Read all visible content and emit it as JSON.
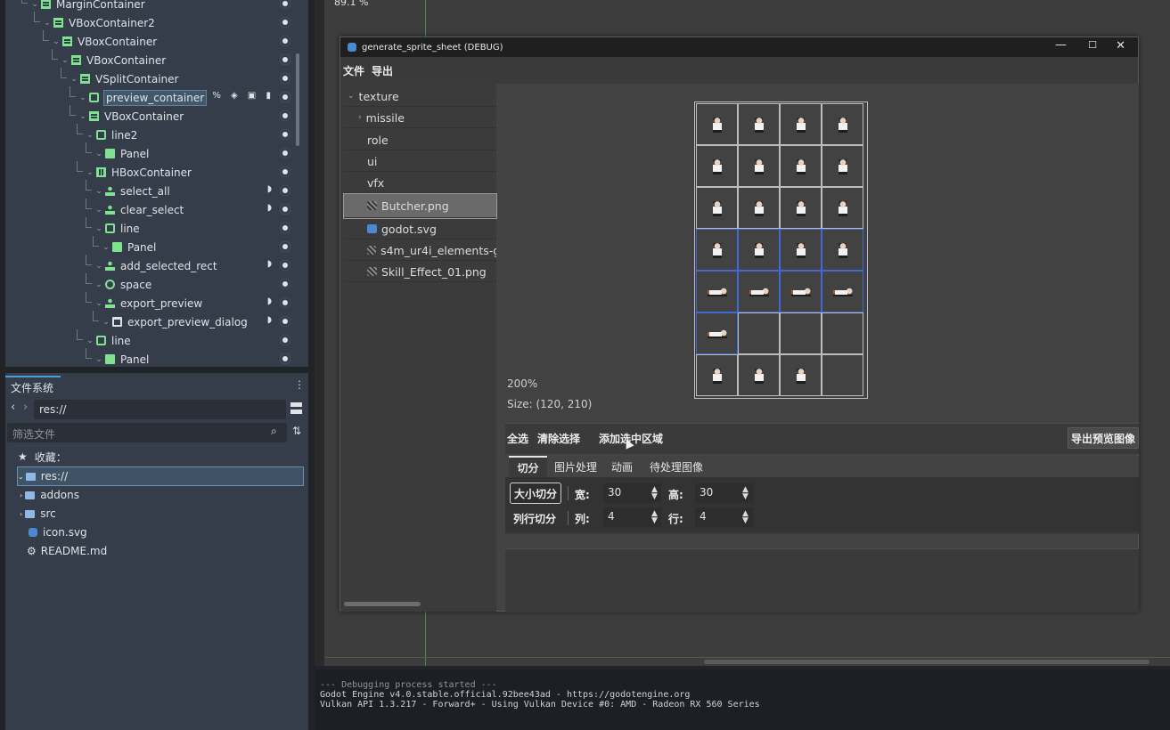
{
  "scene_tree": {
    "rows": [
      {
        "label": "MarginContainer",
        "icon": "vbox-icon",
        "signal": false,
        "indent": 38
      },
      {
        "label": "VBoxContainer2",
        "icon": "vbox-icon",
        "signal": false,
        "indent": 52
      },
      {
        "label": "VBoxContainer",
        "icon": "vbox-icon",
        "signal": false,
        "indent": 62
      },
      {
        "label": "VBoxContainer",
        "icon": "vbox-icon",
        "signal": false,
        "indent": 72
      },
      {
        "label": "VSplitContainer",
        "icon": "vbox-icon",
        "signal": false,
        "indent": 82
      },
      {
        "label": "preview_container",
        "icon": "container-icon",
        "signal": false,
        "indent": 92
      },
      {
        "label": "VBoxContainer",
        "icon": "vbox-icon",
        "signal": false,
        "indent": 92
      },
      {
        "label": "line2",
        "icon": "container-icon",
        "signal": false,
        "indent": 100
      },
      {
        "label": "Panel",
        "icon": "panel-icon",
        "signal": false,
        "indent": 110
      },
      {
        "label": "HBoxContainer",
        "icon": "hbox-icon",
        "signal": false,
        "indent": 100
      },
      {
        "label": "select_all",
        "icon": "button-icon",
        "signal": true,
        "indent": 110
      },
      {
        "label": "clear_select",
        "icon": "button-icon",
        "signal": true,
        "indent": 110
      },
      {
        "label": "line",
        "icon": "container-icon",
        "signal": false,
        "indent": 110
      },
      {
        "label": "Panel",
        "icon": "panel-icon",
        "signal": false,
        "indent": 118
      },
      {
        "label": "add_selected_rect",
        "icon": "button-icon",
        "signal": true,
        "indent": 110
      },
      {
        "label": "space",
        "icon": "space-icon",
        "signal": false,
        "indent": 110
      },
      {
        "label": "export_preview",
        "icon": "button-icon",
        "signal": true,
        "indent": 110
      },
      {
        "label": "export_preview_dialog",
        "icon": "dialog-icon",
        "signal": true,
        "indent": 118
      },
      {
        "label": "line",
        "icon": "container-icon",
        "signal": false,
        "indent": 100
      },
      {
        "label": "Panel",
        "icon": "panel-icon",
        "signal": false,
        "indent": 110
      }
    ],
    "selected_extra_icons": "% ◈ ▣ ▮"
  },
  "filesystem": {
    "tab_label": "文件系统",
    "path": "res://",
    "filter_placeholder": "筛选文件",
    "favorites_label": "收藏：",
    "items": [
      "res://",
      "addons",
      "src",
      "icon.svg",
      "README.md"
    ]
  },
  "viewport": {
    "zoom_label": "89.1 %"
  },
  "log": {
    "lines": [
      "--- Debugging process started ---",
      "Godot Engine v4.0.stable.official.92bee43ad - https://godotengine.org",
      "Vulkan API 1.3.217 - Forward+ - Using Vulkan Device #0: AMD - Radeon RX 560 Series"
    ]
  },
  "dialog": {
    "title": "generate_sprite_sheet (DEBUG)",
    "menu": [
      "文件",
      "导出"
    ],
    "tree": [
      "texture",
      "missile",
      "role",
      "ui",
      "vfx",
      "Butcher.png",
      "godot.svg",
      "s4m_ur4i_elements-ga",
      "Skill_Effect_01.png"
    ],
    "preview": {
      "zoom": "200%",
      "size": "Size: (120, 210)",
      "grid_cols": 4,
      "grid_rows": 7,
      "highlighted_cells": [
        12,
        13,
        14,
        15,
        16,
        17,
        18,
        19,
        20
      ]
    },
    "buttons": {
      "select_all": "全选",
      "clear_select": "清除选择",
      "add_selected": "添加选中区域",
      "export_preview": "导出预览图像"
    },
    "tabs": [
      "切分",
      "图片处理",
      "动画",
      "待处理图像"
    ],
    "split": {
      "size_split": "大小切分",
      "width_label": "宽:",
      "width": "30",
      "height_label": "高:",
      "height": "30",
      "rowcol_split": "列行切分",
      "cols_label": "列:",
      "cols": "4",
      "rows_label": "行:",
      "rows": "4"
    }
  }
}
